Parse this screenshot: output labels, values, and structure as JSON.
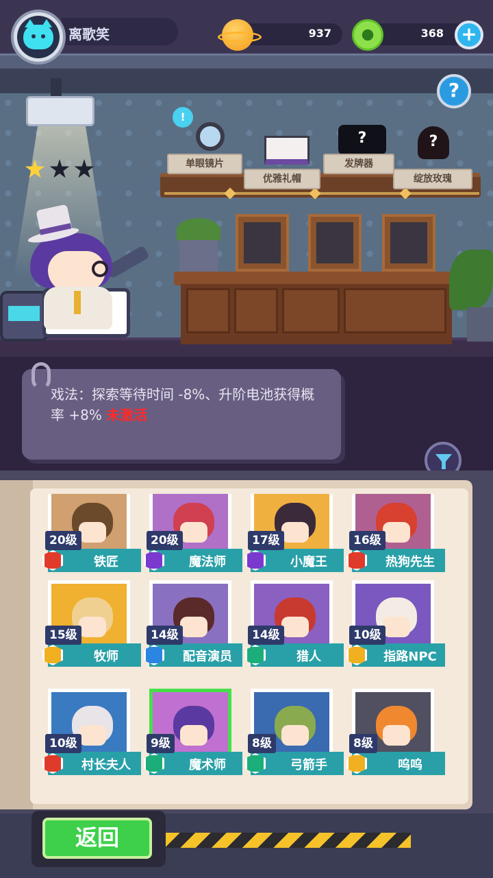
{
  "player": {
    "name": "离歌笑"
  },
  "currencies": {
    "gold": "937",
    "gems": "368"
  },
  "buttons": {
    "plus": "+",
    "help": "?",
    "back": "返回"
  },
  "character": {
    "stars_total": 3,
    "stars_earned": 1
  },
  "props": [
    {
      "label": "单眼镜片",
      "icon": "magnifier-icon"
    },
    {
      "label": "优雅礼帽",
      "icon": "top-hat-icon"
    },
    {
      "label": "发牌器",
      "icon": "unknown-item-icon"
    },
    {
      "label": "绽放玫瑰",
      "icon": "unknown-rose-icon"
    }
  ],
  "description": {
    "text": "戏法：探索等待时间 -8%、升阶电池获得概率 +8% ",
    "status": "未激活"
  },
  "characters": [
    {
      "level": "20级",
      "name": "铁匠",
      "badge": "b-red",
      "bg": "#d0a070",
      "hair": "#6a4a2a"
    },
    {
      "level": "20级",
      "name": "魔法师",
      "badge": "b-purple",
      "bg": "#b070c8",
      "hair": "#d04050"
    },
    {
      "level": "17级",
      "name": "小魔王",
      "badge": "b-purple",
      "bg": "#f0b040",
      "hair": "#3a2a3a"
    },
    {
      "level": "16级",
      "name": "热狗先生",
      "badge": "b-red",
      "bg": "#b06090",
      "hair": "#d84030"
    },
    {
      "level": "15级",
      "name": "牧师",
      "badge": "b-yellow",
      "bg": "#f0b030",
      "hair": "#f0d090"
    },
    {
      "level": "14级",
      "name": "配音演员",
      "badge": "b-blue",
      "bg": "#8a70c0",
      "hair": "#5a2a2a"
    },
    {
      "level": "14级",
      "name": "猎人",
      "badge": "b-green",
      "bg": "#8a60c0",
      "hair": "#c83a30"
    },
    {
      "level": "10级",
      "name": "指路NPC",
      "badge": "b-yellow",
      "bg": "#7a58c0",
      "hair": "#f4ece4"
    },
    {
      "level": "10级",
      "name": "村长夫人",
      "badge": "b-red",
      "bg": "#3a7ac0",
      "hair": "#e8e4e8"
    },
    {
      "level": "9级",
      "name": "魔术师",
      "badge": "b-green",
      "bg": "#c070d0",
      "hair": "#5a3aa0",
      "selected": true
    },
    {
      "level": "8级",
      "name": "弓箭手",
      "badge": "b-green",
      "bg": "#3a6ab0",
      "hair": "#8aaa50"
    },
    {
      "level": "8级",
      "name": "呜呜",
      "badge": "b-yellow",
      "bg": "#505060",
      "hair": "#f08830"
    }
  ]
}
